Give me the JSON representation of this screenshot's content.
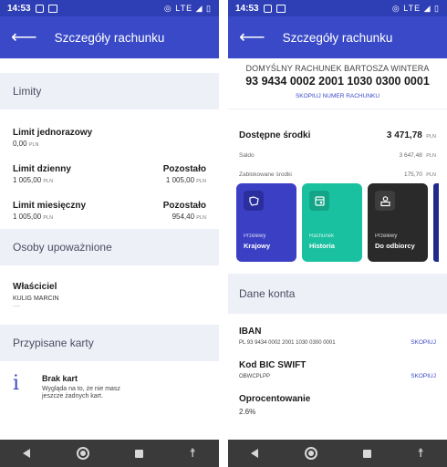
{
  "status": {
    "time": "14:53",
    "network": "◎ LTE ◢ ▯"
  },
  "left": {
    "title": "Szczegóły rachunku",
    "limits": {
      "header": "Limity",
      "single": {
        "label": "Limit jednorazowy",
        "value": "0,00",
        "cur": "PLN"
      },
      "daily": {
        "label": "Limit dzienny",
        "value": "1 005,00",
        "cur": "PLN",
        "rem_label": "Pozostało",
        "rem_value": "1 005,00",
        "rem_cur": "PLN"
      },
      "monthly": {
        "label": "Limit miesięczny",
        "value": "1 005,00",
        "cur": "PLN",
        "rem_label": "Pozostało",
        "rem_value": "954,40",
        "rem_cur": "PLN"
      }
    },
    "authorized": {
      "header": "Osoby upoważnione",
      "owner_label": "Właściciel",
      "owner_name": "KULIG MARCIN",
      "owner_extra": "----"
    },
    "cards": {
      "header": "Przypisane karty",
      "empty_title": "Brak kart",
      "empty_text_1": "Wygląda na to, że nie masz",
      "empty_text_2": "jeszcze żadnych kart."
    }
  },
  "right": {
    "title": "Szczegóły rachunku",
    "account_name": "DOMYŚLNY RACHUNEK BARTOSZA WINTERA",
    "account_number": "93 9434 0002 2001 1030 0300 0001",
    "copy_number": "SKOPIUJ NUMER RACHUNKU",
    "available": {
      "label": "Dostępne środki",
      "value": "3 471,78",
      "cur": "PLN"
    },
    "saldo": {
      "label": "Saldo",
      "value": "3 647,48",
      "cur": "PLN"
    },
    "blocked": {
      "label": "Zablokowane środki",
      "value": "175,70",
      "cur": "PLN"
    },
    "tiles": [
      {
        "small": "Przelewy",
        "big": "Krajowy",
        "color": "#3b3fc4"
      },
      {
        "small": "Rachunek",
        "big": "Historia",
        "color": "#19c1a0"
      },
      {
        "small": "Przelewy",
        "big": "Do odbiorcy",
        "color": "#2a2a2a"
      }
    ],
    "account_data": {
      "header": "Dane konta",
      "iban_label": "IBAN",
      "iban_value": "PL 93 9434 0002 2001 1030 0300 0001",
      "iban_copy": "SKOPIUJ",
      "bic_label": "Kod BIC SWIFT",
      "bic_value": "OBWCPLPP",
      "bic_copy": "SKOPIUJ",
      "interest_label": "Oprocentowanie",
      "interest_value": "2.6%"
    }
  }
}
